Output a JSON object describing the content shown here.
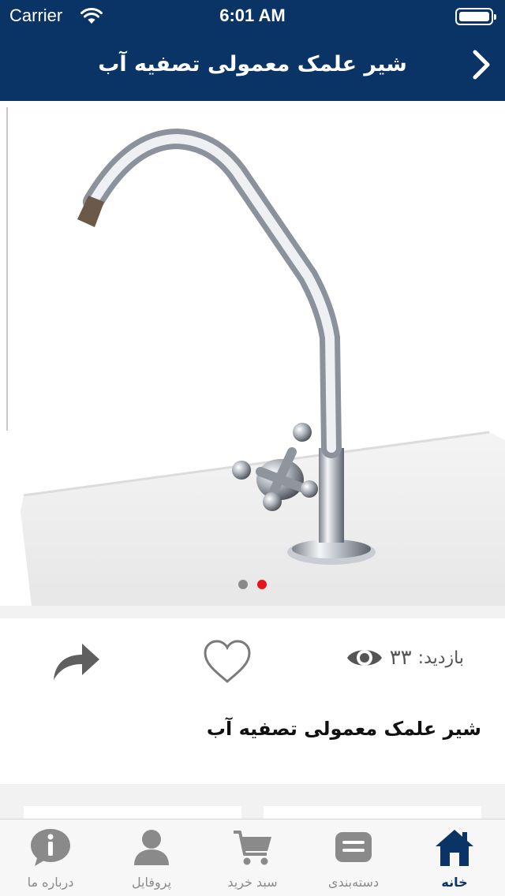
{
  "status_bar": {
    "carrier": "Carrier",
    "time": "6:01 AM"
  },
  "nav": {
    "title": "شیر علمک معمولی تصفیه آب"
  },
  "gallery": {
    "page_count": 2,
    "active_page": 2,
    "active_dot_color": "#e8141d",
    "inactive_dot_color": "#8a8a8a"
  },
  "product": {
    "title": "شیر علمک معمولی تصفیه آب",
    "views_label": "بازدید:",
    "views_count": "۳۳"
  },
  "tabs": [
    {
      "label": "خانه",
      "icon": "home-icon",
      "active": true
    },
    {
      "label": "دسته‌بندی",
      "icon": "category-icon",
      "active": false
    },
    {
      "label": "سبد خرید",
      "icon": "cart-icon",
      "active": false
    },
    {
      "label": "پروفایل",
      "icon": "profile-icon",
      "active": false
    },
    {
      "label": "درباره ما",
      "icon": "info-icon",
      "active": false
    }
  ],
  "colors": {
    "brand": "#0a3366",
    "tab_inactive": "#8a8a8a"
  }
}
